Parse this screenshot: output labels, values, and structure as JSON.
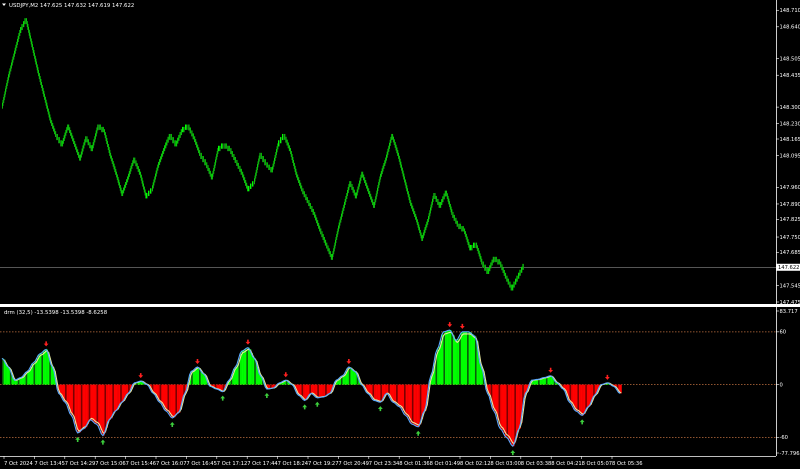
{
  "chart_header": {
    "symbol_info": "USDJPY,M2  147.625 147.632 147.619 147.622"
  },
  "indicator_header": {
    "info": "drm (32,5) -13.5398 -13.5398 -8.6258"
  },
  "price_label": "147.622",
  "colors": {
    "background": "#000000",
    "bull_candle": "#00ff00",
    "bear_candle": "#1a7a1a",
    "hist_up": "#00ff00",
    "hist_down": "#ff0000",
    "arrow_up": "#3ccf3c",
    "arrow_down": "#ff2020",
    "level_line": "#c07040"
  },
  "chart_data": [
    {
      "type": "line",
      "name": "USDJPY M2 renko-style bars",
      "y_axis_ticks": [
        "148.710",
        "148.640",
        "148.505",
        "148.435",
        "148.300",
        "148.230",
        "148.165",
        "148.095",
        "147.960",
        "147.890",
        "147.825",
        "147.750",
        "147.685",
        "147.545",
        "147.475"
      ],
      "current_price": "147.622",
      "x": [
        0,
        6,
        12,
        18,
        24,
        30,
        36,
        42,
        48,
        54,
        60,
        66,
        72,
        78,
        84,
        90,
        96,
        102,
        108,
        114,
        120,
        126,
        132,
        138,
        144,
        150,
        156,
        162,
        168,
        174,
        180,
        186,
        192,
        198,
        204,
        210,
        216,
        222,
        228,
        234,
        240,
        246,
        252,
        258,
        264,
        270,
        276,
        282,
        288,
        294,
        300,
        306,
        312,
        318,
        324,
        330,
        336,
        342,
        348,
        354,
        360,
        366,
        372,
        378,
        384,
        390,
        396,
        402,
        408,
        414,
        420,
        426,
        432,
        438,
        444,
        450,
        456,
        462,
        468,
        474,
        480,
        486,
        492,
        498,
        504,
        510,
        516,
        522,
        528,
        534,
        540,
        546,
        552,
        558,
        564,
        570,
        576,
        582,
        588,
        594,
        600,
        606,
        612,
        618
      ],
      "values": [
        148.3,
        148.42,
        148.52,
        148.62,
        148.67,
        148.56,
        148.45,
        148.35,
        148.25,
        148.18,
        148.14,
        148.22,
        148.15,
        148.08,
        148.17,
        148.12,
        148.22,
        148.2,
        148.1,
        148.02,
        147.93,
        148.0,
        148.08,
        148.02,
        147.92,
        147.95,
        148.05,
        148.12,
        148.18,
        148.14,
        148.2,
        148.22,
        148.17,
        148.1,
        148.06,
        148.0,
        148.12,
        148.14,
        148.12,
        148.07,
        148.02,
        147.95,
        147.98,
        148.1,
        148.06,
        148.03,
        148.14,
        148.18,
        148.12,
        148.02,
        147.95,
        147.9,
        147.85,
        147.78,
        147.72,
        147.66,
        147.78,
        147.88,
        147.98,
        147.92,
        148.02,
        147.95,
        147.88,
        148.0,
        148.08,
        148.18,
        148.1,
        148.0,
        147.9,
        147.83,
        147.74,
        147.82,
        147.93,
        147.88,
        147.94,
        147.85,
        147.8,
        147.78,
        147.7,
        147.72,
        147.64,
        147.6,
        147.66,
        147.64,
        147.58,
        147.53,
        147.58,
        147.63
      ],
      "value_note": "estimated from axis"
    },
    {
      "type": "area",
      "name": "drm histogram",
      "y_axis_ticks": [
        "83.717",
        "60",
        "0",
        "-60",
        "-77.7965"
      ],
      "values": [
        30,
        20,
        5,
        8,
        15,
        25,
        35,
        40,
        20,
        -10,
        -20,
        -35,
        -55,
        -50,
        -40,
        -45,
        -58,
        -40,
        -30,
        -20,
        -10,
        2,
        4,
        0,
        -10,
        -20,
        -30,
        -38,
        -32,
        -10,
        15,
        20,
        12,
        -2,
        -5,
        -8,
        5,
        20,
        38,
        42,
        30,
        10,
        -5,
        -4,
        2,
        5,
        0,
        -12,
        -18,
        -10,
        -15,
        -14,
        -10,
        5,
        10,
        20,
        15,
        0,
        -10,
        -18,
        -20,
        -10,
        -20,
        -25,
        -35,
        -45,
        -48,
        -30,
        10,
        40,
        60,
        62,
        50,
        60,
        60,
        55,
        20,
        -10,
        -30,
        -50,
        -60,
        -70,
        -50,
        -10,
        5,
        6,
        8,
        10,
        2,
        -5,
        -20,
        -30,
        -35,
        -25,
        -12,
        0,
        2,
        -2,
        -10
      ],
      "value_note": "estimated oscillator values"
    }
  ],
  "time_axis": {
    "labels": [
      "7 Oct 2024",
      "7 Oct 13:45",
      "7 Oct 14:29",
      "7 Oct 15:06",
      "7 Oct 15:46",
      "7 Oct 16:07",
      "7 Oct 16:45",
      "7 Oct 17:12",
      "7 Oct 17:44",
      "7 Oct 18:24",
      "7 Oct 19:27",
      "7 Oct 20:49",
      "7 Oct 23:34",
      "8 Oct 01:36",
      "8 Oct 01:49",
      "8 Oct 02:12",
      "8 Oct 03:00",
      "8 Oct 03:38",
      "8 Oct 04:21",
      "8 Oct 05:07",
      "8 Oct 05:36"
    ]
  }
}
